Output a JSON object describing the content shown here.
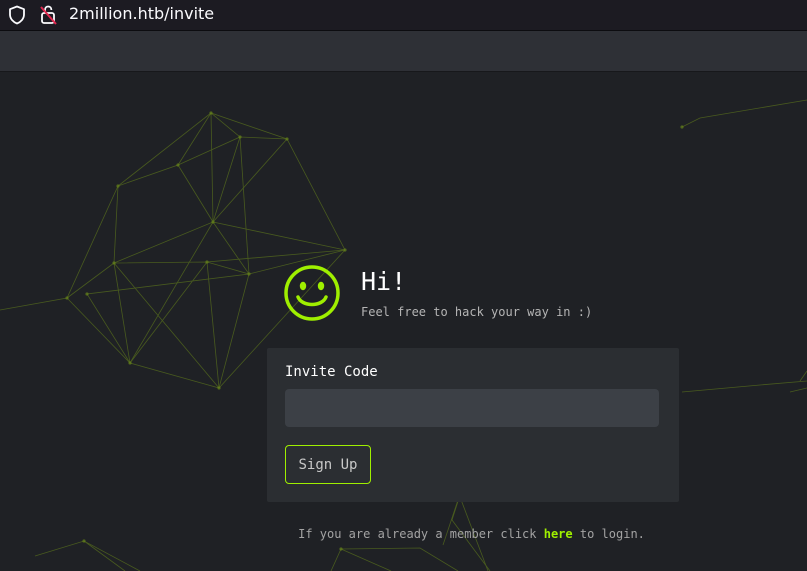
{
  "browser": {
    "url": "2million.htb/invite",
    "icons": [
      "shield-icon",
      "insecure-lock-icon"
    ]
  },
  "hero": {
    "title": "Hi!",
    "subtitle": "Feel free to hack your way in :)",
    "icon": "smiley-icon"
  },
  "form": {
    "label": "Invite Code",
    "input_value": "",
    "input_placeholder": "",
    "button_label": "Sign Up"
  },
  "footer": {
    "prefix": "If you are already a member click ",
    "link": "here",
    "suffix": " to login."
  },
  "colors": {
    "accent": "#9fef00",
    "background": "#1f2125",
    "card": "#2b2e32",
    "input": "#3c4046"
  }
}
